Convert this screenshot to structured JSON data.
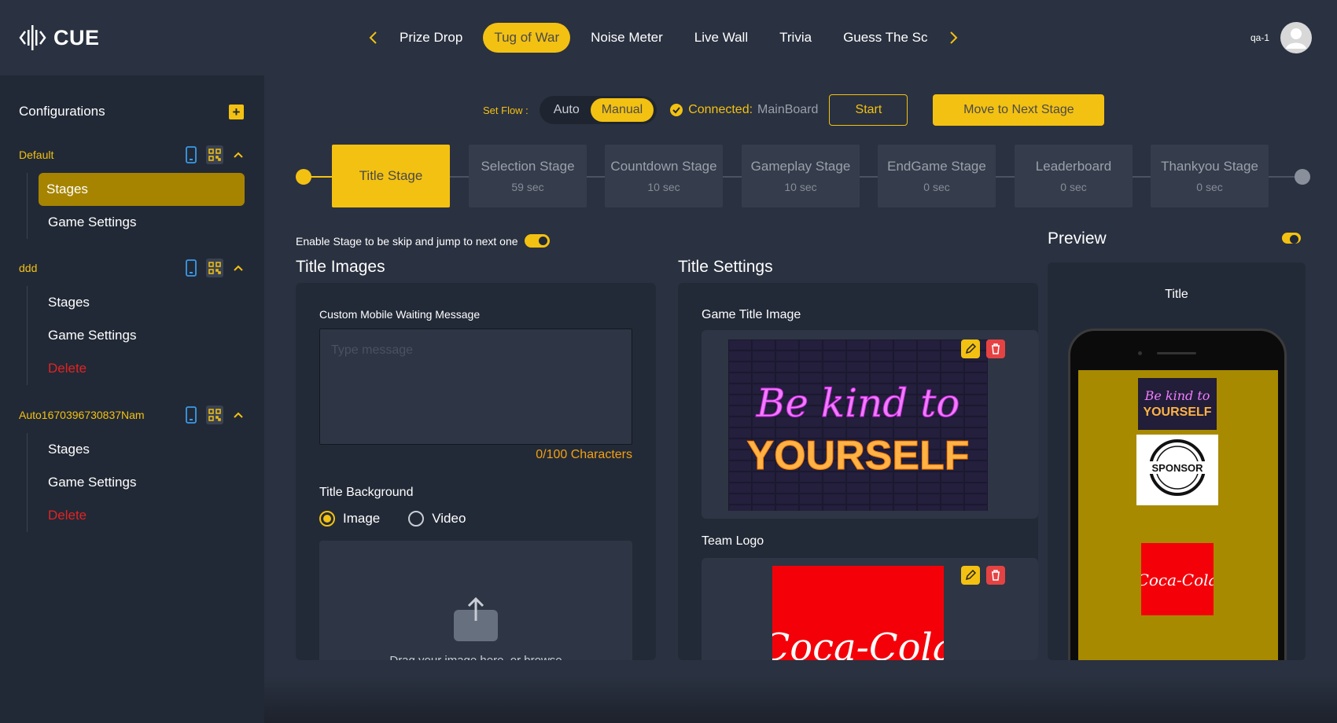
{
  "brand": {
    "name": "CUE"
  },
  "games": {
    "tabs": [
      {
        "label": "Prize Drop",
        "active": false
      },
      {
        "label": "Tug of War",
        "active": true
      },
      {
        "label": "Noise Meter",
        "active": false
      },
      {
        "label": "Live Wall",
        "active": false
      },
      {
        "label": "Trivia",
        "active": false
      },
      {
        "label": "Guess The Sc",
        "active": false
      }
    ],
    "prev_icon": "chevron-left-icon",
    "next_icon": "chevron-right-icon"
  },
  "user": {
    "name": "qa-1",
    "avatar_icon": "user-icon"
  },
  "sidebar": {
    "title": "Configurations",
    "add_icon": "plus-icon",
    "configs": [
      {
        "name": "Default",
        "items": [
          {
            "label": "Stages",
            "active": true
          },
          {
            "label": "Game Settings",
            "active": false
          }
        ]
      },
      {
        "name": "ddd",
        "items": [
          {
            "label": "Stages",
            "active": false
          },
          {
            "label": "Game Settings",
            "active": false
          },
          {
            "label": "Delete",
            "active": false,
            "danger": true
          }
        ]
      },
      {
        "name": "Auto1670396730837Nam",
        "items": [
          {
            "label": "Stages",
            "active": false
          },
          {
            "label": "Game Settings",
            "active": false
          },
          {
            "label": "Delete",
            "active": false,
            "danger": true
          }
        ]
      }
    ]
  },
  "flow": {
    "label": "Set Flow :",
    "options": [
      "Auto",
      "Manual"
    ],
    "selected": "Manual",
    "connected_label": "Connected:",
    "connected_value": "MainBoard",
    "start_label": "Start",
    "next_label": "Move to Next Stage"
  },
  "stages": [
    {
      "name": "Title Stage",
      "time": "",
      "active": true
    },
    {
      "name": "Selection Stage",
      "time": "59 sec",
      "active": false
    },
    {
      "name": "Countdown Stage",
      "time": "10 sec",
      "active": false
    },
    {
      "name": "Gameplay Stage",
      "time": "10 sec",
      "active": false
    },
    {
      "name": "EndGame Stage",
      "time": "0 sec",
      "active": false
    },
    {
      "name": "Leaderboard",
      "time": "0 sec",
      "active": false
    },
    {
      "name": "Thankyou Stage",
      "time": "0 sec",
      "active": false
    }
  ],
  "skip": {
    "label": "Enable Stage to be skip and jump to next one",
    "enabled": true
  },
  "title_images": {
    "heading": "Title Images",
    "waiting_label": "Custom Mobile Waiting Message",
    "waiting_placeholder": "Type message",
    "counter": "0/100 Characters",
    "bg_label": "Title Background",
    "bg_options": [
      "Image",
      "Video"
    ],
    "bg_selected": "Image",
    "upload_text": "Drag your image here, or browse"
  },
  "title_settings": {
    "heading": "Title Settings",
    "game_title_label": "Game Title Image",
    "game_title_art": "Be kind to YOURSELF",
    "team_logo_label": "Team Logo",
    "team_logo_art": "Coca-Cola"
  },
  "preview": {
    "heading": "Preview",
    "enabled": true,
    "phone_title": "Title",
    "sponsor_text": "SPONSOR",
    "bg_color": "#a88a00"
  },
  "colors": {
    "accent": "#f3c112",
    "danger": "#e02424",
    "bg": "#2a3140",
    "panel": "#232a37"
  }
}
